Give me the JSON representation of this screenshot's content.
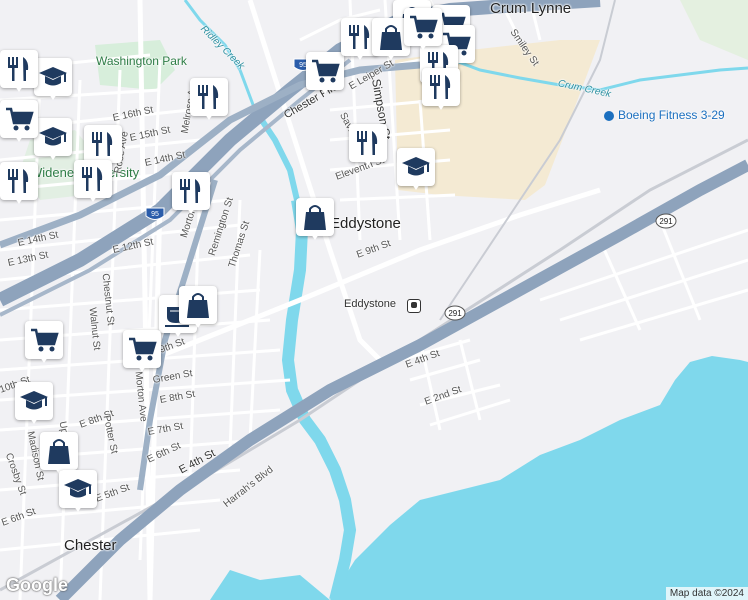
{
  "places": [
    {
      "id": "eddystone",
      "text": "Eddystone"
    },
    {
      "id": "chester",
      "text": "Chester"
    },
    {
      "id": "crum-lynne",
      "text": "Crum Lynne"
    },
    {
      "id": "washington-park",
      "text": "Washington Park"
    },
    {
      "id": "widener-university",
      "text": "Widener University"
    }
  ],
  "water_labels": [
    {
      "id": "ridley-creek",
      "text": "Ridley Creek"
    },
    {
      "id": "crum-creek",
      "text": "Crum Creek"
    }
  ],
  "poi": {
    "text": "Boeing Fitness 3-29"
  },
  "station": {
    "text": "Eddystone"
  },
  "streets": [
    "E 16th St",
    "E 15th St",
    "E 14th St",
    "E 14th St",
    "E 13th St",
    "E 12th St",
    "Remington St",
    "Thomas St",
    "Chestnut St",
    "Walnut St",
    "Morton Ave",
    "Morton Ave",
    "E 9th St",
    "9th St",
    "Green St",
    "E 8th St",
    "E 8th St",
    "E 7th St",
    "E 6th St",
    "E 6th St",
    "E 5th St",
    "E 4th St",
    "E 4th St",
    "E 2nd St",
    "Harrah's Blvd",
    "Potter St",
    "Upland St",
    "Crosby St",
    "Madison St",
    "Simpson St",
    "Saville Ave",
    "Eleventh St",
    "Smiley St",
    "Chester Pike",
    "E Leiper St",
    "Rose Ave",
    "Melrose Ave",
    "10th St"
  ],
  "highways": [
    "95",
    "95",
    "291",
    "291"
  ],
  "markers": [
    {
      "type": "school"
    },
    {
      "type": "restaurant"
    },
    {
      "type": "school"
    },
    {
      "type": "restaurant"
    },
    {
      "type": "restaurant"
    },
    {
      "type": "restaurant"
    },
    {
      "type": "restaurant"
    },
    {
      "type": "grocery"
    },
    {
      "type": "restaurant"
    },
    {
      "type": "grocery"
    },
    {
      "type": "shopping"
    },
    {
      "type": "grocery"
    },
    {
      "type": "restaurant"
    },
    {
      "type": "restaurant"
    },
    {
      "type": "grocery"
    },
    {
      "type": "restaurant"
    },
    {
      "type": "restaurant"
    },
    {
      "type": "school"
    },
    {
      "type": "shopping"
    },
    {
      "type": "cafe"
    },
    {
      "type": "shopping"
    },
    {
      "type": "grocery"
    },
    {
      "type": "grocery"
    },
    {
      "type": "school"
    },
    {
      "type": "shopping"
    },
    {
      "type": "school"
    },
    {
      "type": "shopping"
    },
    {
      "type": "grocery"
    }
  ],
  "attribution": "Map data ©2024",
  "logo": "Google",
  "colors": {
    "water": "#7fd8ec",
    "land": "#f1f1f4",
    "highway": "#8ea3bc",
    "industrial": "#f4ead3",
    "park": "#d7eedb",
    "marker_icon": "#1f3a5f"
  }
}
